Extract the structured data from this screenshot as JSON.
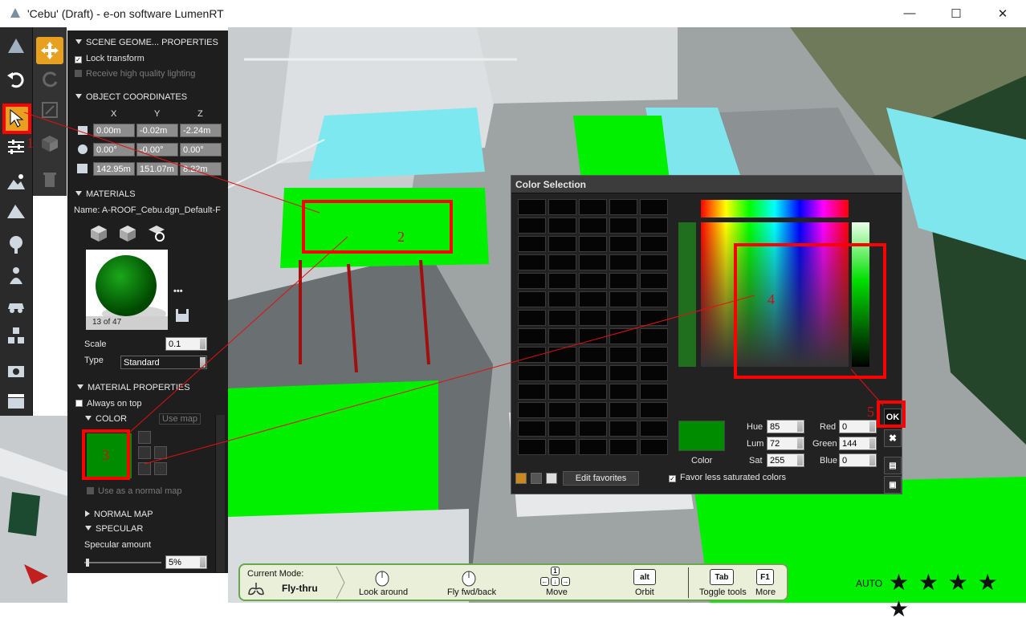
{
  "window": {
    "title": "'Cebu' (Draft) - e-on software LumenRT"
  },
  "panel": {
    "scene_geometry": "SCENE GEOME... PROPERTIES",
    "lock_transform": "Lock transform",
    "receive_lighting": "Receive high quality lighting",
    "object_coordinates": "OBJECT COORDINATES",
    "axis_x": "X",
    "axis_y": "Y",
    "axis_z": "Z",
    "position": [
      "0.00m",
      "-0.02m",
      "-2.24m"
    ],
    "rotation": [
      "0.00°",
      "-0.00°",
      "0.00°"
    ],
    "size": [
      "142.95m",
      "151.07m",
      "8.22m"
    ],
    "materials": "MATERIALS",
    "material_name": "Name:  A-ROOF_Cebu.dgn_Default-F",
    "material_index": "13 of 47",
    "more": "•••",
    "scale_label": "Scale",
    "scale_value": "0.1",
    "type_label": "Type",
    "type_value": "Standard",
    "material_properties": "MATERIAL PROPERTIES",
    "always_on_top": "Always on top",
    "color": "COLOR",
    "use_map": "Use map",
    "normal_map_toggle": "Use as a normal map",
    "normal_map": "NORMAL MAP",
    "specular": "SPECULAR",
    "specular_amount": "Specular amount",
    "specular_value": "5%"
  },
  "dialog": {
    "title": "Color Selection",
    "color_label": "Color",
    "hue_label": "Hue",
    "hue": "85",
    "lum_label": "Lum",
    "lum": "72",
    "sat_label": "Sat",
    "sat": "255",
    "red_label": "Red",
    "red": "0",
    "green_label": "Green",
    "green": "144",
    "blue_label": "Blue",
    "blue": "0",
    "edit_favorites": "Edit favorites",
    "favor_less": "Favor less saturated colors",
    "ok": "OK",
    "close": "✖",
    "selected_color": "#008c00"
  },
  "annotations": {
    "n1": "1",
    "n2": "2",
    "n3": "3",
    "n4": "4",
    "n5": "5"
  },
  "navbar": {
    "current_mode_label": "Current Mode:",
    "current_mode": "Fly-thru",
    "look_around": "Look around",
    "fly_fwd_back": "Fly fwd/back",
    "move": "Move",
    "orbit": "Orbit",
    "orbit_key": "alt",
    "toggle_tools": "Toggle tools",
    "toggle_key": "Tab",
    "more": "More",
    "more_key": "F1",
    "move_key": "1"
  },
  "quality": {
    "auto": "AUTO",
    "stars": "★ ★ ★ ★ ★"
  }
}
